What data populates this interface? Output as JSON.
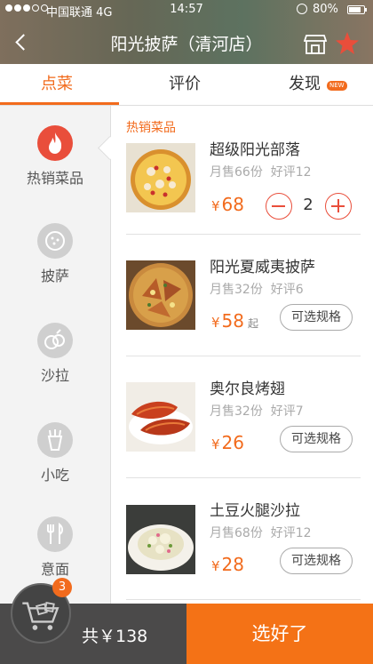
{
  "status_bar": {
    "carrier": "中国联通",
    "network": "4G",
    "time": "14:57",
    "battery": "80%"
  },
  "header": {
    "title": "阳光披萨（清河店）"
  },
  "tabs": [
    {
      "label": "点菜",
      "active": true
    },
    {
      "label": "评价",
      "active": false
    },
    {
      "label": "发现",
      "active": false,
      "badge": "NEW"
    }
  ],
  "sidebar": {
    "items": [
      {
        "label": "热销菜品",
        "icon": "fire-icon",
        "active": true
      },
      {
        "label": "披萨",
        "icon": "pizza-icon",
        "active": false
      },
      {
        "label": "沙拉",
        "icon": "salad-icon",
        "active": false
      },
      {
        "label": "小吃",
        "icon": "snack-icon",
        "active": false
      },
      {
        "label": "意面",
        "icon": "fork-knife-icon",
        "active": false
      }
    ]
  },
  "menu": {
    "section_title": "热销菜品",
    "items": [
      {
        "name": "超级阳光部落",
        "sales": "月售66份",
        "rating": "好评12",
        "currency": "¥",
        "price": "68",
        "quantity": "2"
      },
      {
        "name": "阳光夏威夷披萨",
        "sales": "月售32份",
        "rating": "好评6",
        "currency": "¥",
        "price": "58",
        "price_suffix": "起",
        "action": "可选规格"
      },
      {
        "name": "奥尔良烤翅",
        "sales": "月售32份",
        "rating": "好评7",
        "currency": "¥",
        "price": "26",
        "action": "可选规格"
      },
      {
        "name": "土豆火腿沙拉",
        "sales": "月售68份",
        "rating": "好评12",
        "currency": "¥",
        "price": "28",
        "action": "可选规格"
      }
    ]
  },
  "cart": {
    "badge_count": "3",
    "total": "共￥138",
    "checkout_label": "选好了"
  },
  "colors": {
    "accent": "#f26b1d",
    "active_category": "#e94e3b",
    "bottom_bar": "#4b4a4a",
    "checkout": "#f47216"
  }
}
